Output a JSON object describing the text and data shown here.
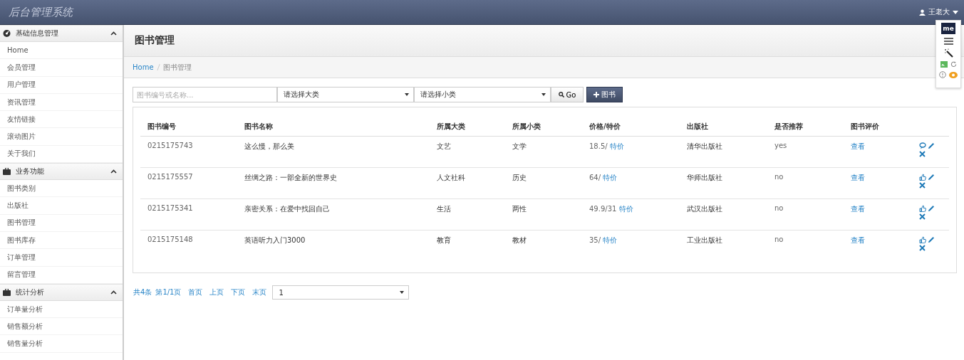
{
  "app_title": "后台管理系统",
  "user": {
    "name": "王老大"
  },
  "sidebar": [
    {
      "title": "基础信息管理",
      "expanded": true,
      "items": [
        "Home",
        "会员管理",
        "用户管理",
        "资讯管理",
        "友情链接",
        "滚动图片",
        "关于我们"
      ]
    },
    {
      "title": "业务功能",
      "expanded": true,
      "items": [
        "图书类别",
        "出版社",
        "图书管理",
        "图书库存",
        "订单管理",
        "留言管理"
      ]
    },
    {
      "title": "统计分析",
      "expanded": true,
      "items": [
        "订单量分析",
        "销售额分析",
        "销售量分析"
      ]
    }
  ],
  "page_title": "图书管理",
  "breadcrumb": [
    "Home",
    "图书管理"
  ],
  "toolbar": {
    "search_placeholder": "图书编号或名称...",
    "category": "请选择大类",
    "subcategory": "请选择小类",
    "go_button": "Go",
    "add_button": "图书"
  },
  "table": {
    "columns": [
      "图书编号",
      "图书名称",
      "所属大类",
      "所属小类",
      "价格/特价",
      "出版社",
      "是否推荐",
      "图书评价"
    ],
    "rows": [
      {
        "id": "0215175743",
        "name": "这么慢，那么美",
        "category": "文艺",
        "subcategory": "文学",
        "price": "18.5/",
        "special": "特价",
        "publisher": "清华出版社",
        "recommended": "yes",
        "review": "查看",
        "kind": "comment"
      },
      {
        "id": "0215175557",
        "name": "丝绸之路：一部全新的世界史",
        "category": "人文社科",
        "subcategory": "历史",
        "price": "64/",
        "special": "特价",
        "publisher": "华师出版社",
        "recommended": "no",
        "review": "查看",
        "kind": "thumb"
      },
      {
        "id": "0215175341",
        "name": "亲密关系：在爱中找回自己",
        "category": "生活",
        "subcategory": "两性",
        "price": "49.9/31",
        "special": "特价",
        "publisher": "武汉出版社",
        "recommended": "no",
        "review": "查看",
        "kind": "thumb"
      },
      {
        "id": "0215175148",
        "name": "英语听力入门3000",
        "category": "教育",
        "subcategory": "教材",
        "price": "35/",
        "special": "特价",
        "publisher": "工业出版社",
        "recommended": "no",
        "review": "查看",
        "kind": "thumb"
      }
    ]
  },
  "pagination": {
    "total": "共4条",
    "page": "第1/1页",
    "links": [
      "首页",
      "上页",
      "下页",
      "末页"
    ],
    "page_select": "1"
  },
  "extension": {
    "logo": "me"
  }
}
